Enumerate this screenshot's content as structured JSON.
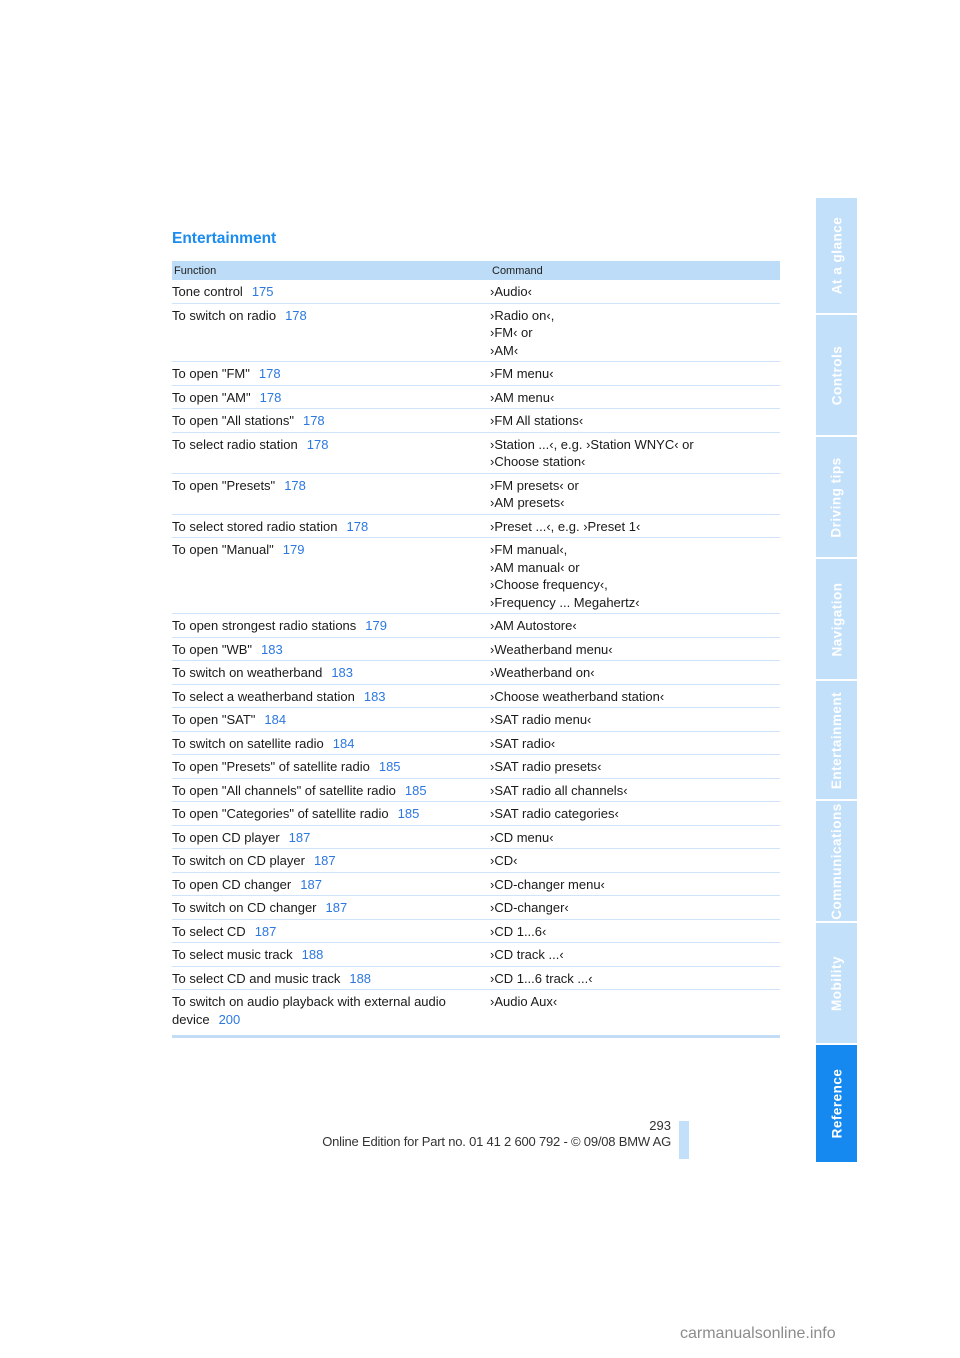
{
  "section_title": "Entertainment",
  "table": {
    "headers": {
      "function": "Function",
      "command": "Command"
    },
    "rows": [
      {
        "function": "Tone control",
        "page": "175",
        "command": [
          "›Audio‹"
        ]
      },
      {
        "function": "To switch on radio",
        "page": "178",
        "command": [
          "›Radio on‹,",
          "›FM‹ or",
          "›AM‹"
        ]
      },
      {
        "function": "To open \"FM\"",
        "page": "178",
        "command": [
          "›FM menu‹"
        ]
      },
      {
        "function": "To open \"AM\"",
        "page": "178",
        "command": [
          "›AM menu‹"
        ]
      },
      {
        "function": "To open \"All stations\"",
        "page": "178",
        "command": [
          "›FM All stations‹"
        ]
      },
      {
        "function": "To select radio station",
        "page": "178",
        "command": [
          "›Station ...‹, e.g. ›Station WNYC‹ or",
          "›Choose station‹"
        ]
      },
      {
        "function": "To open \"Presets\"",
        "page": "178",
        "command": [
          "›FM presets‹ or",
          "›AM presets‹"
        ]
      },
      {
        "function": "To select stored radio station",
        "page": "178",
        "command": [
          "›Preset ...‹, e.g. ›Preset 1‹"
        ]
      },
      {
        "function": "To open \"Manual\"",
        "page": "179",
        "command": [
          "›FM manual‹,",
          "›AM manual‹ or",
          "›Choose frequency‹,",
          "›Frequency ... Megahertz‹"
        ]
      },
      {
        "function": "To open strongest radio stations",
        "page": "179",
        "command": [
          "›AM Autostore‹"
        ]
      },
      {
        "function": "To open \"WB\"",
        "page": "183",
        "command": [
          "›Weatherband menu‹"
        ]
      },
      {
        "function": "To switch on weatherband",
        "page": "183",
        "command": [
          "›Weatherband on‹"
        ]
      },
      {
        "function": "To select a weatherband station",
        "page": "183",
        "command": [
          "›Choose weatherband station‹"
        ]
      },
      {
        "function": "To open \"SAT\"",
        "page": "184",
        "command": [
          "›SAT radio menu‹"
        ]
      },
      {
        "function": "To switch on satellite radio",
        "page": "184",
        "command": [
          "›SAT radio‹"
        ]
      },
      {
        "function": "To open \"Presets\" of satellite radio",
        "page": "185",
        "command": [
          "›SAT radio presets‹"
        ]
      },
      {
        "function": "To open \"All channels\" of satellite radio",
        "page": "185",
        "command": [
          "›SAT radio all channels‹"
        ]
      },
      {
        "function": "To open \"Categories\" of satellite radio",
        "page": "185",
        "command": [
          "›SAT radio categories‹"
        ]
      },
      {
        "function": "To open CD player",
        "page": "187",
        "command": [
          "›CD menu‹"
        ]
      },
      {
        "function": "To switch on CD player",
        "page": "187",
        "command": [
          "›CD‹"
        ]
      },
      {
        "function": "To open CD changer",
        "page": "187",
        "command": [
          "›CD-changer menu‹"
        ]
      },
      {
        "function": "To switch on CD changer",
        "page": "187",
        "command": [
          "›CD-changer‹"
        ]
      },
      {
        "function": "To select CD",
        "page": "187",
        "command": [
          "›CD 1...6‹"
        ]
      },
      {
        "function": "To select music track",
        "page": "188",
        "command": [
          "›CD track ...‹"
        ]
      },
      {
        "function": "To select CD and music track",
        "page": "188",
        "command": [
          "›CD 1...6 track ...‹"
        ]
      },
      {
        "function": "To switch on audio playback with external audio device",
        "page": "200",
        "command": [
          "›Audio Aux‹"
        ]
      }
    ]
  },
  "sidebar": {
    "tabs": [
      {
        "label": "At a glance",
        "active": false
      },
      {
        "label": "Controls",
        "active": false
      },
      {
        "label": "Driving tips",
        "active": false
      },
      {
        "label": "Navigation",
        "active": false
      },
      {
        "label": "Entertainment",
        "active": false
      },
      {
        "label": "Communications",
        "active": false
      },
      {
        "label": "Mobility",
        "active": false
      },
      {
        "label": "Reference",
        "active": true
      }
    ]
  },
  "footer": {
    "page_number": "293",
    "edition_text": "Online Edition for Part no. 01 41 2 600 792 - © 09/08 BMW AG"
  },
  "watermark": "carmanualsonline.info",
  "colors": {
    "accent": "#1a8cf0",
    "tab_inactive": "#c3e0fa",
    "tab_active": "#1689f0",
    "header_bg": "#bcdcf7",
    "link": "#2c78e0"
  }
}
